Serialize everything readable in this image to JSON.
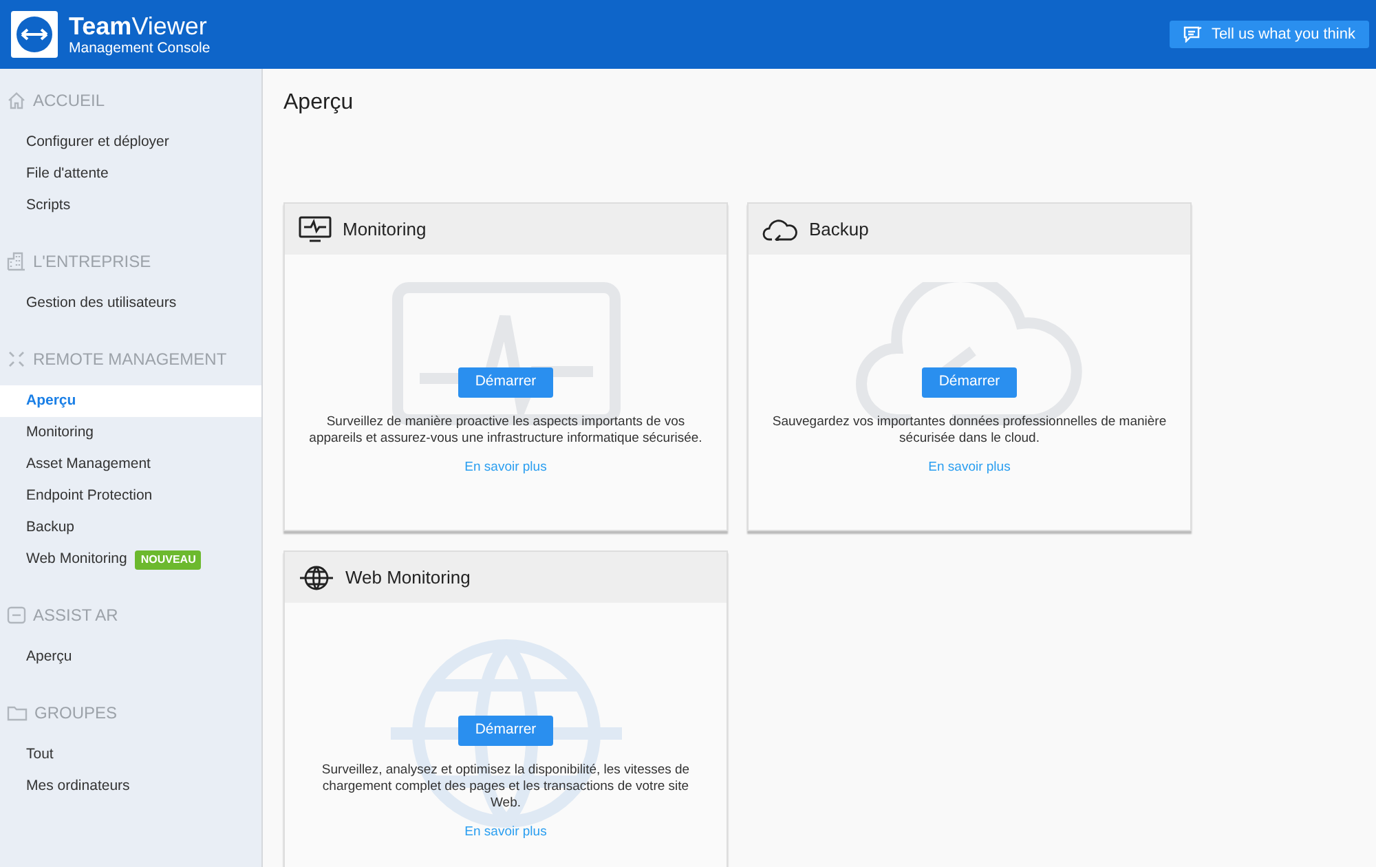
{
  "header": {
    "logo_title": "**Team**Viewer",
    "logo_subtitle": "Management Console",
    "feedback_button": "Tell us what you think"
  },
  "sidebar": {
    "sections": [
      {
        "title": "ACCUEIL",
        "items": [
          {
            "label": "Configurer et déployer",
            "selected": false
          },
          {
            "label": "File d'attente",
            "selected": false
          },
          {
            "label": "Scripts",
            "selected": false
          }
        ]
      },
      {
        "title": "L'ENTREPRISE",
        "items": [
          {
            "label": "Gestion des utilisateurs",
            "selected": false
          }
        ]
      },
      {
        "title": "REMOTE MANAGEMENT",
        "items": [
          {
            "label": "Aperçu",
            "selected": true
          },
          {
            "label": "Monitoring",
            "selected": false
          },
          {
            "label": "Asset Management",
            "selected": false
          },
          {
            "label": "Endpoint Protection",
            "selected": false
          },
          {
            "label": "Backup",
            "selected": false
          },
          {
            "label": "Web Monitoring",
            "selected": false,
            "badge": "NOUVEAU"
          }
        ]
      },
      {
        "title": "ASSIST AR",
        "items": [
          {
            "label": "Aperçu",
            "selected": false
          }
        ]
      },
      {
        "title": "GROUPES",
        "items": [
          {
            "label": "Tout",
            "selected": false
          },
          {
            "label": "Mes ordinateurs",
            "selected": false
          }
        ]
      }
    ]
  },
  "page_title": "Aperçu",
  "cards": [
    {
      "title": "Monitoring",
      "button": "Démarrer",
      "description": "Surveillez de manière proactive les aspects importants de vos appareils et assurez-vous une infrastructure informatique sécurisée.",
      "link": "En savoir plus"
    },
    {
      "title": "Backup",
      "button": "Démarrer",
      "description": "Sauvegardez vos importantes données professionnelles de manière sécurisée dans le cloud.",
      "link": "En savoir plus"
    },
    {
      "title": "Web Monitoring",
      "button": "Démarrer",
      "description": "Surveillez, analysez et optimisez la disponibilité, les vitesses de chargement complet des pages et les transactions de votre site Web.",
      "link": "En savoir plus"
    }
  ]
}
